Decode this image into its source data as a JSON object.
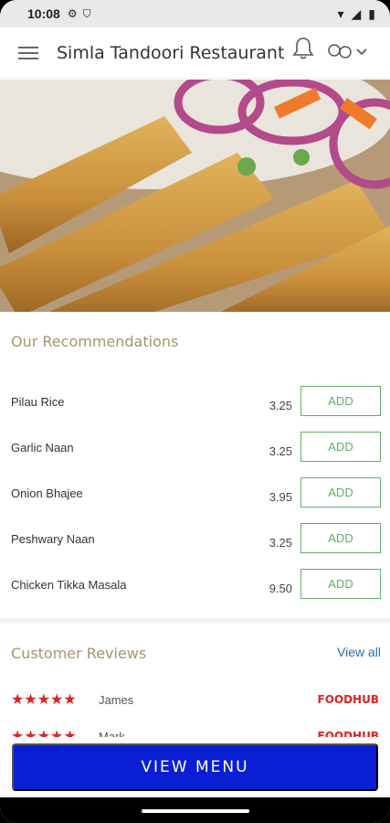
{
  "status": {
    "time": "10:08"
  },
  "header": {
    "title": "Simla Tandoori Restaurant"
  },
  "recommendations": {
    "title": "Our Recommendations",
    "add_label": "ADD",
    "items": [
      {
        "name": "Pilau Rice",
        "price": "3.25"
      },
      {
        "name": "Garlic Naan",
        "price": "3.25"
      },
      {
        "name": "Onion Bhajee",
        "price": "3.95"
      },
      {
        "name": "Peshwary Naan",
        "price": "3.25"
      },
      {
        "name": "Chicken Tikka Masala",
        "price": "9.50"
      }
    ]
  },
  "reviews": {
    "title": "Customer Reviews",
    "view_all": "View all",
    "items": [
      {
        "stars": "★★★★★",
        "rating": 5,
        "name": "James",
        "source": "FOODHUB"
      },
      {
        "stars": "★★★★★",
        "rating": 5,
        "name": "Mark",
        "source": "FOODHUB"
      }
    ]
  },
  "cta": {
    "label": "VIEW MENU"
  },
  "colors": {
    "accent": "#0a1fd4",
    "add_border": "#5fae6b",
    "section_title": "#a3966b",
    "star": "#dd2222"
  }
}
